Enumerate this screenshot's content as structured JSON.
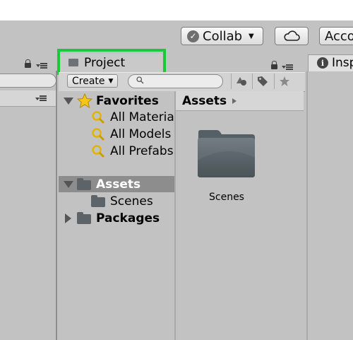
{
  "toolbar": {
    "collab_label": "Collab",
    "account_label": "Acco"
  },
  "project_tab": {
    "label": "Project"
  },
  "project_toolbar": {
    "create_label": "Create",
    "search_placeholder": ""
  },
  "tree": {
    "favorites_label": "Favorites",
    "favorites": [
      "All Materia",
      "All Models",
      "All Prefabs"
    ],
    "assets_label": "Assets",
    "scenes_label": "Scenes",
    "packages_label": "Packages"
  },
  "assets": {
    "breadcrumb": "Assets",
    "items": [
      {
        "label": "Scenes",
        "icon": "folder-icon"
      }
    ]
  },
  "inspector": {
    "tab_label": "Insp"
  },
  "colors": {
    "highlight": "#19c83b",
    "panel_bg": "#c2c2c2",
    "selected_row": "#8d8d8d",
    "folder": "#5c646a"
  }
}
